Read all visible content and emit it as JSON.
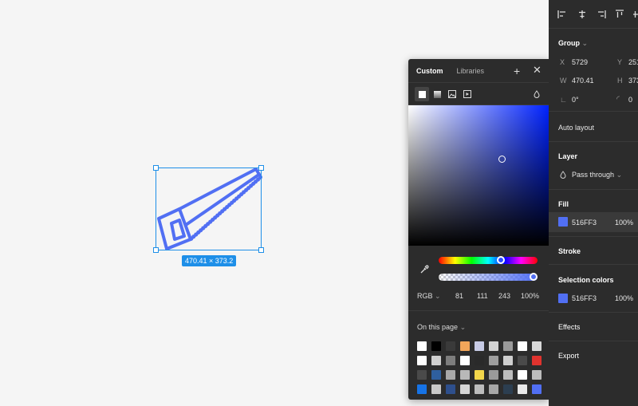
{
  "canvas": {
    "selection_size": "470.41 × 373.2",
    "object_color": "#516ff3",
    "selection_color": "#1e8fe8"
  },
  "color_picker": {
    "tabs": [
      "Custom",
      "Libraries"
    ],
    "active_tab": "Custom",
    "add_icon": "plus-icon",
    "close_icon": "close-icon",
    "fill_type_icons": [
      "solid-fill-icon",
      "gradient-fill-icon",
      "image-fill-icon",
      "video-fill-icon"
    ],
    "blend_icon": "droplet-icon",
    "color_model": "RGB",
    "r": "81",
    "g": "111",
    "b": "243",
    "opacity": "100%",
    "hex": "#516ff3",
    "page_colors_label": "On this page",
    "swatches": [
      "#ffffff",
      "#000000",
      "#3a3a3a",
      "#f2a65a",
      "#c7cbe6",
      "#d3d3d3",
      "#9a9a9a",
      "#ffffff",
      "#d9d9d9",
      "#ffffff",
      "#d0d0d0",
      "#7d7d7d",
      "#ffffff",
      "#2a2a2a",
      "#9e9e9e",
      "#cfcfcf",
      "#4a4a4a",
      "#e0332e",
      "#4a4a4a",
      "#2f5f9e",
      "#a8a8a8",
      "#b8b8b8",
      "#f2d64b",
      "#9a9a9a",
      "#bdbdbd",
      "#ffffff",
      "#bdbdbd",
      "#1673e6",
      "#c8c8c8",
      "#2e4f8c",
      "#d6d6d6",
      "#bcbcbc",
      "#a7a7a7",
      "#2c3e50",
      "#e9e9e9",
      "#516ff3"
    ]
  },
  "properties": {
    "align_icons": [
      "align-left-icon",
      "align-center-horizontal-icon",
      "align-right-icon",
      "align-top-icon",
      "align-middle-vertical-icon"
    ],
    "group_label": "Group",
    "x_label": "X",
    "x_value": "5729",
    "y_label": "Y",
    "y_value": "251",
    "w_label": "W",
    "w_value": "470.41",
    "h_label": "H",
    "h_value": "373",
    "rotation": "0°",
    "corner_radius": "0",
    "auto_layout": "Auto layout",
    "layer_title": "Layer",
    "blend_mode": "Pass through",
    "fill_title": "Fill",
    "fill_hex": "516FF3",
    "fill_opacity": "100%",
    "stroke_title": "Stroke",
    "selection_colors_title": "Selection colors",
    "selection_hex": "516FF3",
    "selection_opacity": "100%",
    "effects_title": "Effects",
    "export_title": "Export"
  }
}
